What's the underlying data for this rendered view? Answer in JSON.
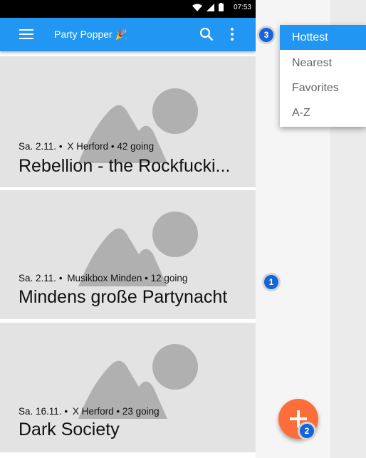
{
  "status_bar": {
    "time": "07:53"
  },
  "app_bar": {
    "title": "Party Popper",
    "title_emoji": "🎉",
    "menu_icon": "hamburger-menu-icon",
    "search_icon": "search-icon",
    "more_icon": "more-vert-icon"
  },
  "events": [
    {
      "date": "Sa. 2.11.",
      "separator": "•",
      "venue": "X Herford",
      "going": "42 going",
      "name": "Rebellion - the Rockfucki..."
    },
    {
      "date": "Sa. 2.11.",
      "separator": "•",
      "venue": "Musikbox Minden",
      "going": "12 going",
      "name": "Mindens große Partynacht"
    },
    {
      "date": "Sa. 16.11.",
      "separator": "•",
      "venue": "X Herford",
      "going": "23 going",
      "name": "Dark Society"
    }
  ],
  "sort_menu": {
    "items": [
      "Hottest",
      "Nearest",
      "Favorites",
      "A-Z"
    ],
    "selected": "Hottest"
  },
  "fab": {
    "icon": "plus-icon"
  },
  "markers": [
    "1",
    "2",
    "3"
  ],
  "colors": {
    "primary": "#2196f3",
    "accent": "#ff6d3a",
    "card": "#e3e3e3",
    "placeholder": "#b0b0b0"
  }
}
